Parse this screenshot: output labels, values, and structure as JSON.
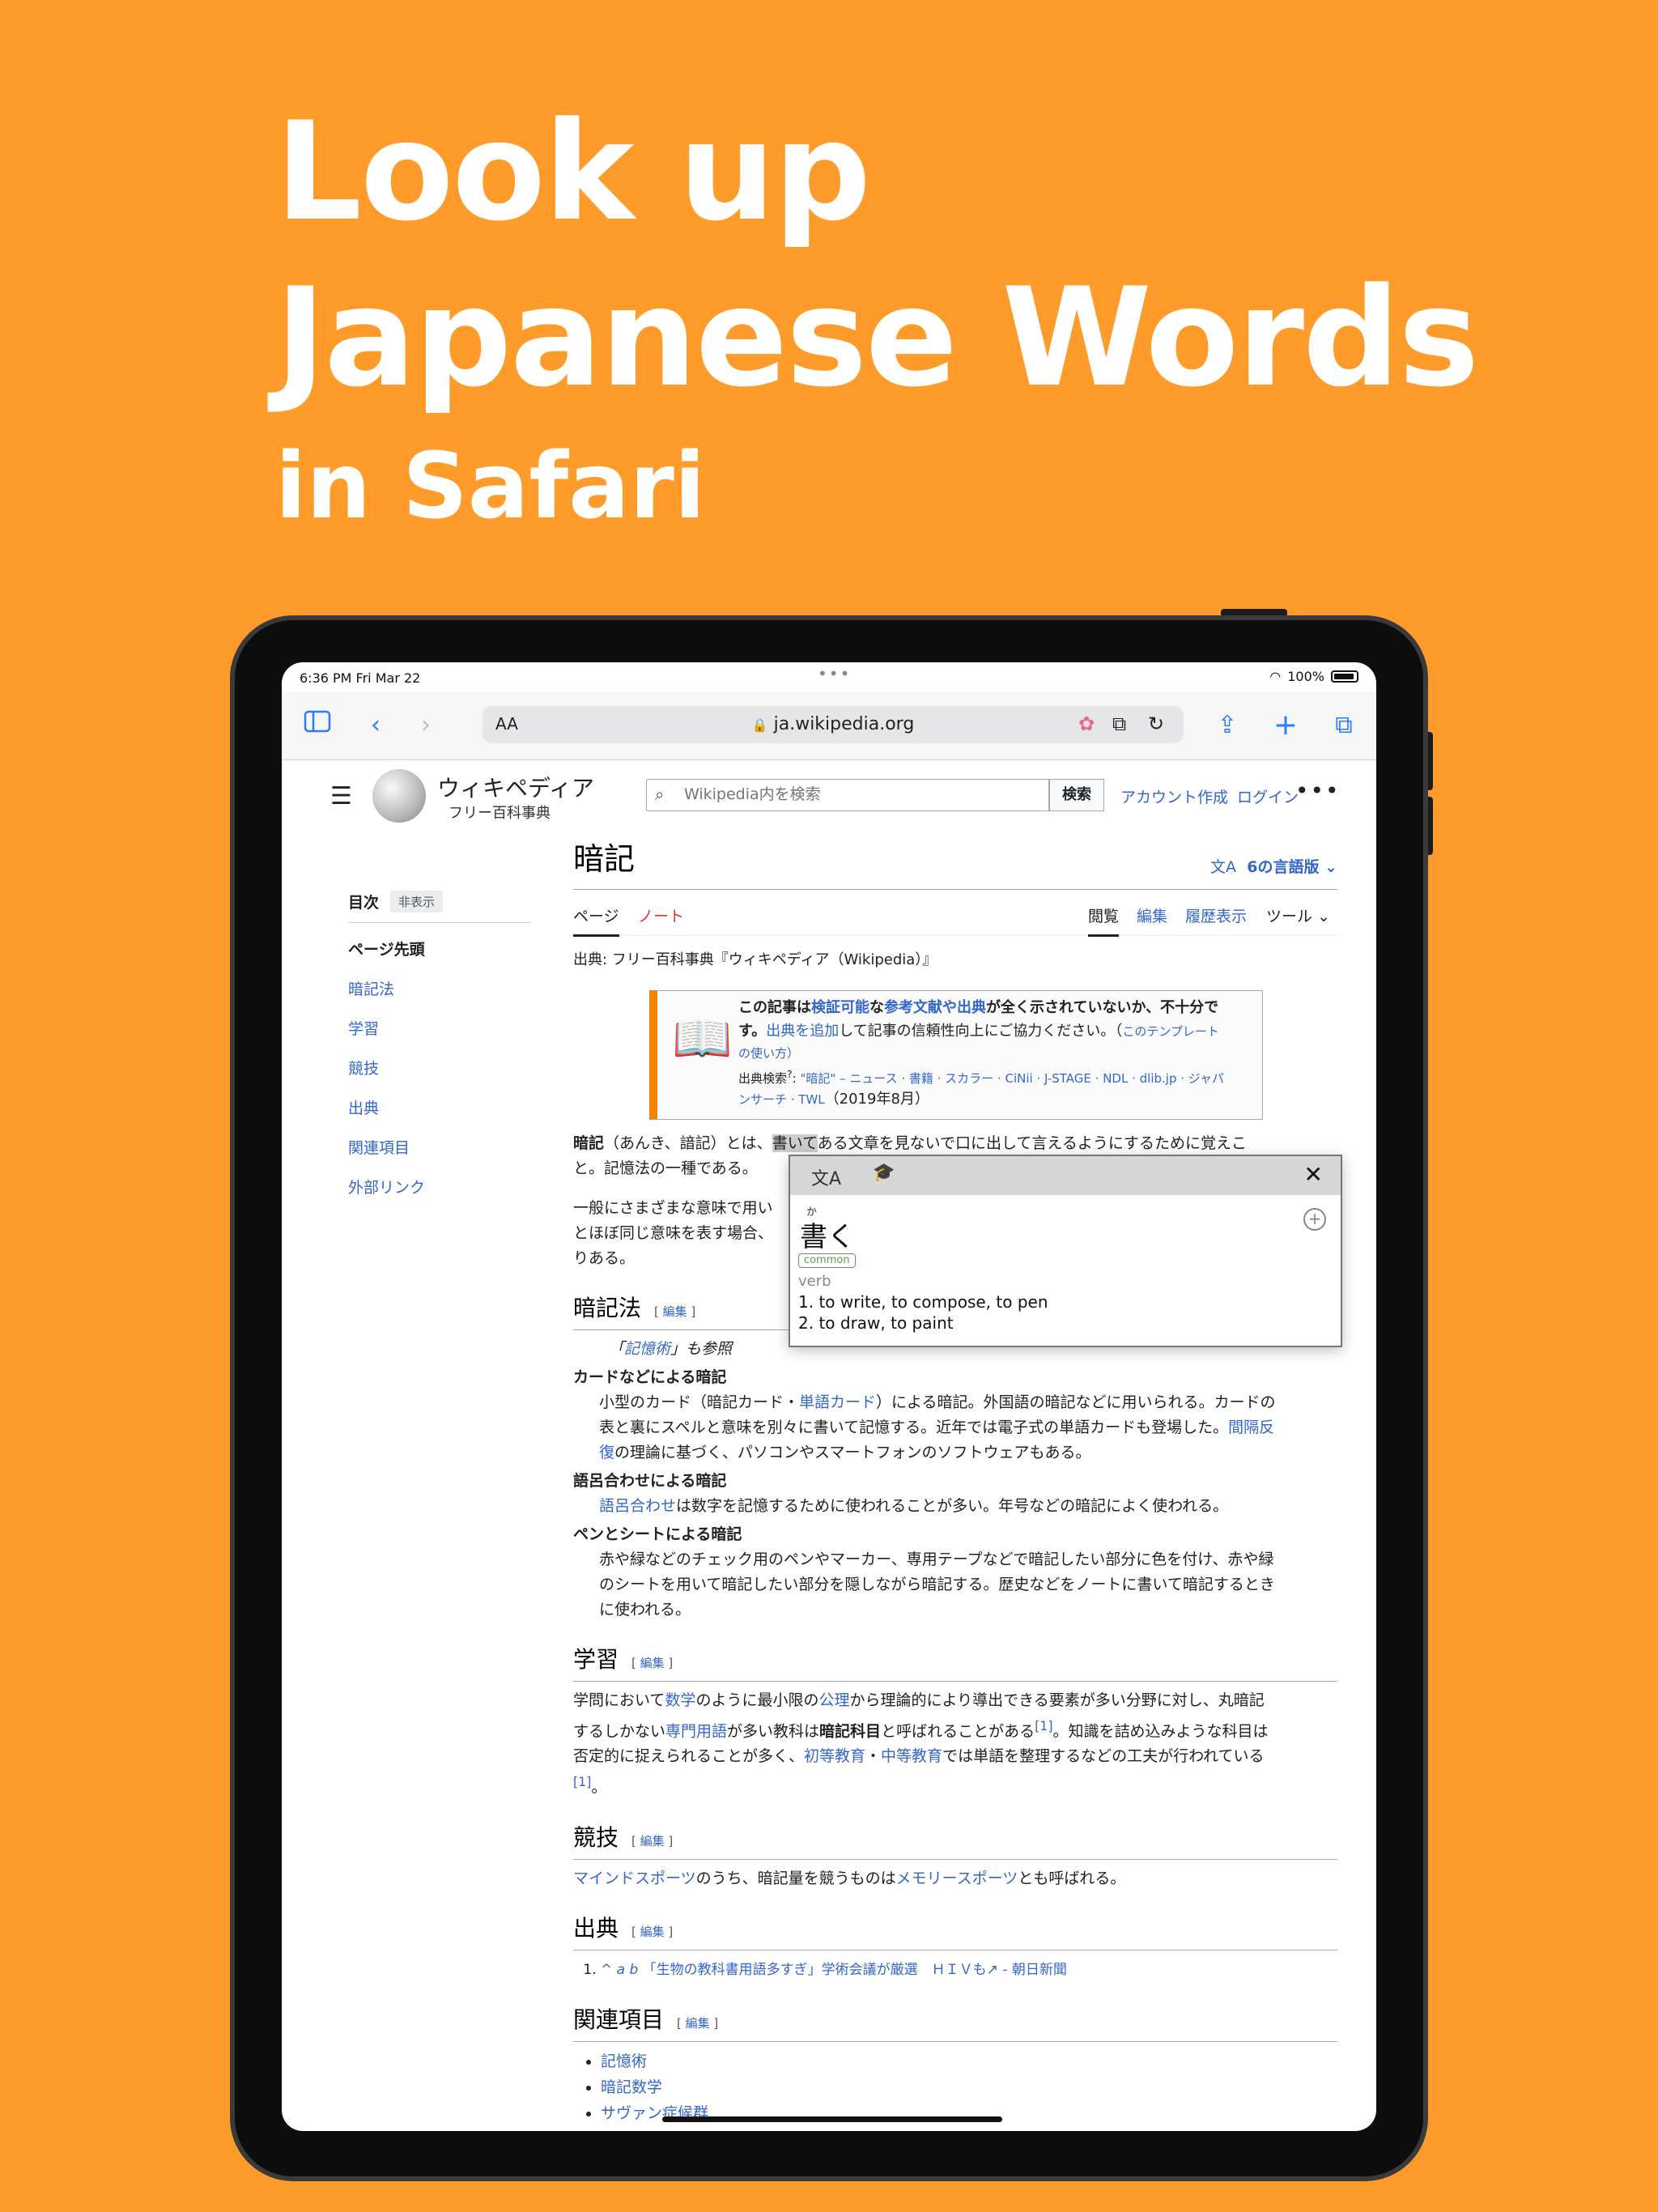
{
  "hero": {
    "line1": "Look up",
    "line2": "Japanese Words",
    "line3": "in Safari"
  },
  "status": {
    "time": "6:36 PM   Fri Mar 22",
    "battery": "100%"
  },
  "browser": {
    "url": "ja.wikipedia.org",
    "text_size": "AA",
    "icons": {
      "sidebar": "sidebar-icon",
      "back": "back-icon",
      "forward": "forward-icon",
      "lock": "lock-icon",
      "reload": "reload-icon",
      "share": "share-icon",
      "new_tab": "plus-icon",
      "tabs": "tabs-icon"
    }
  },
  "wiki": {
    "site_name": "ウィキペディア",
    "site_sub": "フリー百科事典",
    "search_placeholder": "Wikipedia内を検索",
    "search_button": "検索",
    "create_account": "アカウント作成",
    "login": "ログイン"
  },
  "toc": {
    "title": "目次",
    "hide": "非表示",
    "top": "ページ先頭",
    "items": [
      "暗記法",
      "学習",
      "競技",
      "出典",
      "関連項目",
      "外部リンク"
    ]
  },
  "article": {
    "title": "暗記",
    "languages": "6の言語版",
    "tabs": {
      "page": "ページ",
      "talk": "ノート",
      "read": "閲覧",
      "edit": "編集",
      "history": "履歴表示",
      "tools": "ツール"
    },
    "from": "出典: フリー百科事典『ウィキペディア（Wikipedia）』",
    "ambox": {
      "l1a": "この記事は",
      "l1b": "検証可能",
      "l1c": "な",
      "l1d": "参考文献や出典",
      "l1e": "が全く示されていないか、不十分で",
      "l2a": "す。",
      "l2b": "出典を追加",
      "l2c": "して記事の信頼性向上にご協力ください。（",
      "l2d": "このテンプレート",
      "l3": "の使い方）",
      "l4a": "出典検索",
      "l4b": "\"暗記\" – ニュース · 書籍 · スカラー · CiNii · J-STAGE · NDL · dlib.jp · ジャパ",
      "l5a": "ンサーチ · TWL",
      "l5b": "（2019年8月）"
    },
    "intro1a": "暗記",
    "intro1b": "（あんき、諳記）とは、",
    "intro1hl": "書いて",
    "intro1c": "ある文章を見ないで口に出して言えるようにするために覚えこ",
    "intro1d": "と。記憶法の一種である。",
    "intro2a": "一般にさまざまな意味で用い",
    "intro2b": "とほぼ同じ意味を表す場合、",
    "intro2c": "りある。",
    "edit_label": "編集",
    "s1": {
      "title": "暗記法",
      "hatnote_link": "記憶術",
      "hatnote_rest": "」も参照",
      "dt1": "カードなどによる暗記",
      "dd1a": "小型のカード（暗記カード・",
      "dd1b": "単語カード",
      "dd1c": "）による暗記。外国語の暗記などに用いられる。カードの",
      "dd1d": "表と裏にスペルと意味を別々に書いて記憶する。近年では電子式の単語カードも登場した。",
      "dd1e": "間隔反",
      "dd1f": "復",
      "dd1g": "の理論に基づく、パソコンやスマートフォンのソフトウェアもある。",
      "dt2": "語呂合わせによる暗記",
      "dd2a": "語呂合わせ",
      "dd2b": "は数字を記憶するために使われることが多い。年号などの暗記によく使われる。",
      "dt3": "ペンとシートによる暗記",
      "dd3a": "赤や緑などのチェック用のペンやマーカー、専用テープなどで暗記したい部分に色を付け、赤や緑",
      "dd3b": "のシートを用いて暗記したい部分を隠しながら暗記する。歴史などをノートに書いて暗記するとき",
      "dd3c": "に使われる。"
    },
    "s2": {
      "title": "学習",
      "p1a": "学問において",
      "p1b": "数学",
      "p1c": "のように最小限の",
      "p1d": "公理",
      "p1e": "から理論的により導出できる要素が多い分野に対し、丸暗記",
      "p2a": "するしかない",
      "p2b": "専門用語",
      "p2c": "が多い教科は",
      "p2d": "暗記科目",
      "p2e": "と呼ばれることがある",
      "p2f": "[1]",
      "p2g": "。知識を詰め込みような科目は",
      "p3a": "否定的に捉えられることが多く、",
      "p3b": "初等教育",
      "p3c": "・",
      "p3d": "中等教育",
      "p3e": "では単語を整理するなどの工夫が行われている",
      "p4a": "[1]",
      "p4b": "。"
    },
    "s3": {
      "title": "競技",
      "pa": "マインドスポーツ",
      "pb": "のうち、暗記量を競うものは",
      "pc": "メモリースポーツ",
      "pd": "とも呼ばれる。"
    },
    "s4": {
      "title": "出典",
      "ref_caret": "^ a b",
      "ref_text": "「生物の教科書用語多すぎ」学術会議が厳選　ＨＩＶも",
      "ref_source": " - 朝日新聞"
    },
    "s5": {
      "title": "関連項目",
      "items": [
        "記憶術",
        "暗記数学",
        "サヴァン症候群"
      ]
    }
  },
  "popup": {
    "furigana": "か",
    "word": "書く",
    "badge": "common",
    "pos": "verb",
    "sense1": "1. to write, to compose, to pen",
    "sense2": "2. to draw, to paint"
  },
  "colors": {
    "background": "#FF9B2B",
    "link": "#3366cc",
    "safari_blue": "#2b7cf6",
    "talk": "#d33"
  }
}
